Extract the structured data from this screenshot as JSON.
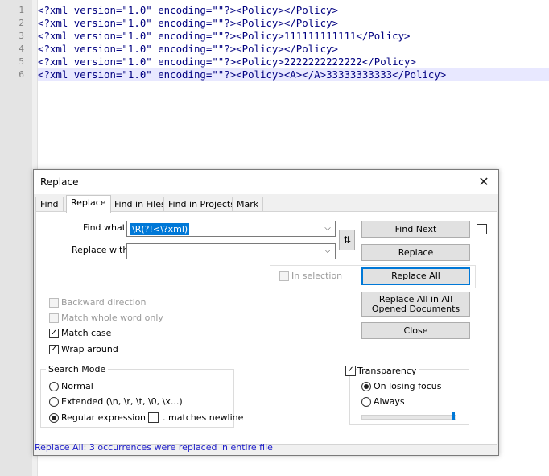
{
  "editor": {
    "line_numbers": [
      "1",
      "2",
      "3",
      "4",
      "5",
      "6"
    ],
    "lines": [
      "<?xml version=\"1.0\" encoding=\"\"?><Policy></Policy>",
      "<?xml version=\"1.0\" encoding=\"\"?><Policy></Policy>",
      "<?xml version=\"1.0\" encoding=\"\"?><Policy>111111111111</Policy>",
      "<?xml version=\"1.0\" encoding=\"\"?><Policy></Policy>",
      "<?xml version=\"1.0\" encoding=\"\"?><Policy>2222222222222</Policy>",
      "<?xml version=\"1.0\" encoding=\"\"?><Policy><A></A>33333333333</Policy>"
    ],
    "current_line": 6
  },
  "dialog": {
    "title": "Replace",
    "close_icon": "close-icon",
    "tabs": [
      "Find",
      "Replace",
      "Find in Files",
      "Find in Projects",
      "Mark"
    ],
    "active_tab": "Replace",
    "find_what_label": "Find what :",
    "find_what_value": "\\R(?!<\\?xml)",
    "replace_with_label": "Replace with :",
    "replace_with_value": "",
    "swap_icon": "swap-arrows-icon",
    "buttons": {
      "find_next": "Find Next",
      "replace": "Replace",
      "replace_all": "Replace All",
      "replace_all_opened": "Replace All in All Opened Documents",
      "close": "Close"
    },
    "in_selection_label": "In selection",
    "options": {
      "backward_direction": {
        "label": "Backward direction",
        "checked": false,
        "enabled": false
      },
      "match_whole_word": {
        "label": "Match whole word only",
        "checked": false,
        "enabled": false
      },
      "match_case": {
        "label": "Match case",
        "checked": true,
        "enabled": true
      },
      "wrap_around": {
        "label": "Wrap around",
        "checked": true,
        "enabled": true
      }
    },
    "search_mode": {
      "title": "Search Mode",
      "normal": "Normal",
      "extended": "Extended (\\n, \\r, \\t, \\0, \\x...)",
      "regex": "Regular expression",
      "selected": "regex",
      "dot_newline": ". matches newline"
    },
    "transparency": {
      "title": "Transparency",
      "checked": true,
      "on_losing_focus": "On losing focus",
      "always": "Always",
      "selected": "on_losing_focus",
      "level": 1.0
    },
    "status": "Replace All: 3 occurrences were replaced in entire file"
  },
  "colors": {
    "editor_text": "#000080",
    "current_line_bg": "#e8e8ff",
    "status_text": "#1c1cc8",
    "accent": "#0078d7"
  }
}
